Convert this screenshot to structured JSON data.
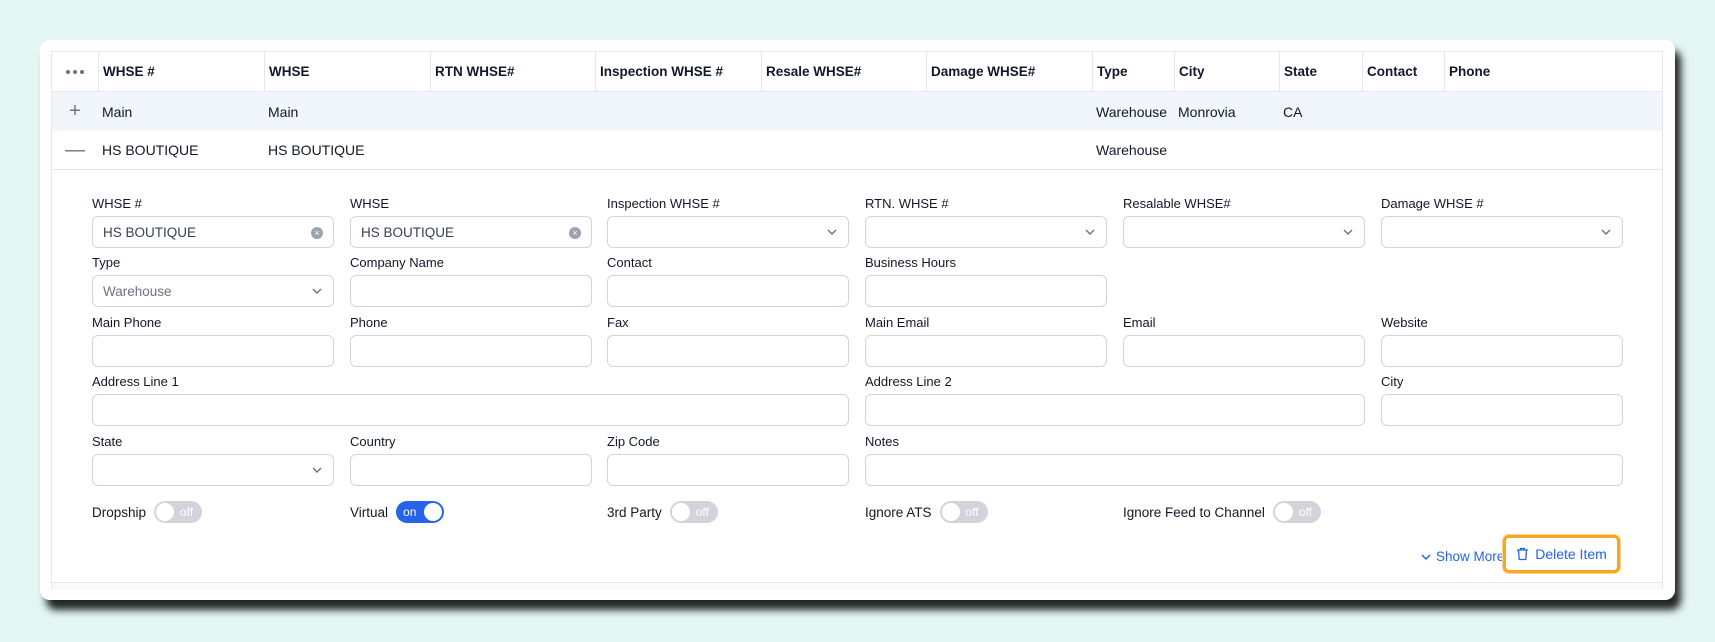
{
  "table": {
    "columns": [
      "WHSE #",
      "WHSE",
      "RTN WHSE#",
      "Inspection WHSE #",
      "Resale WHSE#",
      "Damage WHSE#",
      "Type",
      "City",
      "State",
      "Contact",
      "Phone"
    ],
    "rows": [
      {
        "expander": "+",
        "whse_no": "Main",
        "whse": "Main",
        "type": "Warehouse",
        "city": "Monrovia",
        "state": "CA"
      },
      {
        "expander": "—",
        "whse_no": "HS BOUTIQUE",
        "whse": "HS BOUTIQUE",
        "type": "Warehouse",
        "city": "",
        "state": ""
      }
    ]
  },
  "detail": {
    "whse_no": {
      "label": "WHSE #",
      "value": "HS BOUTIQUE"
    },
    "whse": {
      "label": "WHSE",
      "value": "HS BOUTIQUE"
    },
    "inspection": {
      "label": "Inspection WHSE #",
      "value": ""
    },
    "rtn": {
      "label": "RTN. WHSE #",
      "value": ""
    },
    "resalable": {
      "label": "Resalable WHSE#",
      "value": ""
    },
    "damage": {
      "label": "Damage WHSE #",
      "value": ""
    },
    "type": {
      "label": "Type",
      "value": "Warehouse"
    },
    "company": {
      "label": "Company Name",
      "value": ""
    },
    "contact": {
      "label": "Contact",
      "value": ""
    },
    "hours": {
      "label": "Business Hours",
      "value": ""
    },
    "main_phone": {
      "label": "Main Phone",
      "value": ""
    },
    "phone": {
      "label": "Phone",
      "value": ""
    },
    "fax": {
      "label": "Fax",
      "value": ""
    },
    "main_email": {
      "label": "Main Email",
      "value": ""
    },
    "email": {
      "label": "Email",
      "value": ""
    },
    "website": {
      "label": "Website",
      "value": ""
    },
    "addr1": {
      "label": "Address Line 1",
      "value": ""
    },
    "addr2": {
      "label": "Address Line 2",
      "value": ""
    },
    "city": {
      "label": "City",
      "value": ""
    },
    "state": {
      "label": "State",
      "value": ""
    },
    "country": {
      "label": "Country",
      "value": ""
    },
    "zip": {
      "label": "Zip Code",
      "value": ""
    },
    "notes": {
      "label": "Notes",
      "value": ""
    }
  },
  "toggles": {
    "dropship": {
      "label": "Dropship",
      "state": "off"
    },
    "virtual": {
      "label": "Virtual",
      "state": "on"
    },
    "third_party": {
      "label": "3rd Party",
      "state": "off"
    },
    "ignore_ats": {
      "label": "Ignore ATS",
      "state": "off"
    },
    "ignore_feed": {
      "label": "Ignore Feed to Channel",
      "state": "off"
    }
  },
  "actions": {
    "show_more": "Show More",
    "delete": "Delete Item"
  },
  "colors": {
    "accent": "#2563eb",
    "highlight": "#f5a623",
    "row_highlight": "#f1f6fd"
  }
}
